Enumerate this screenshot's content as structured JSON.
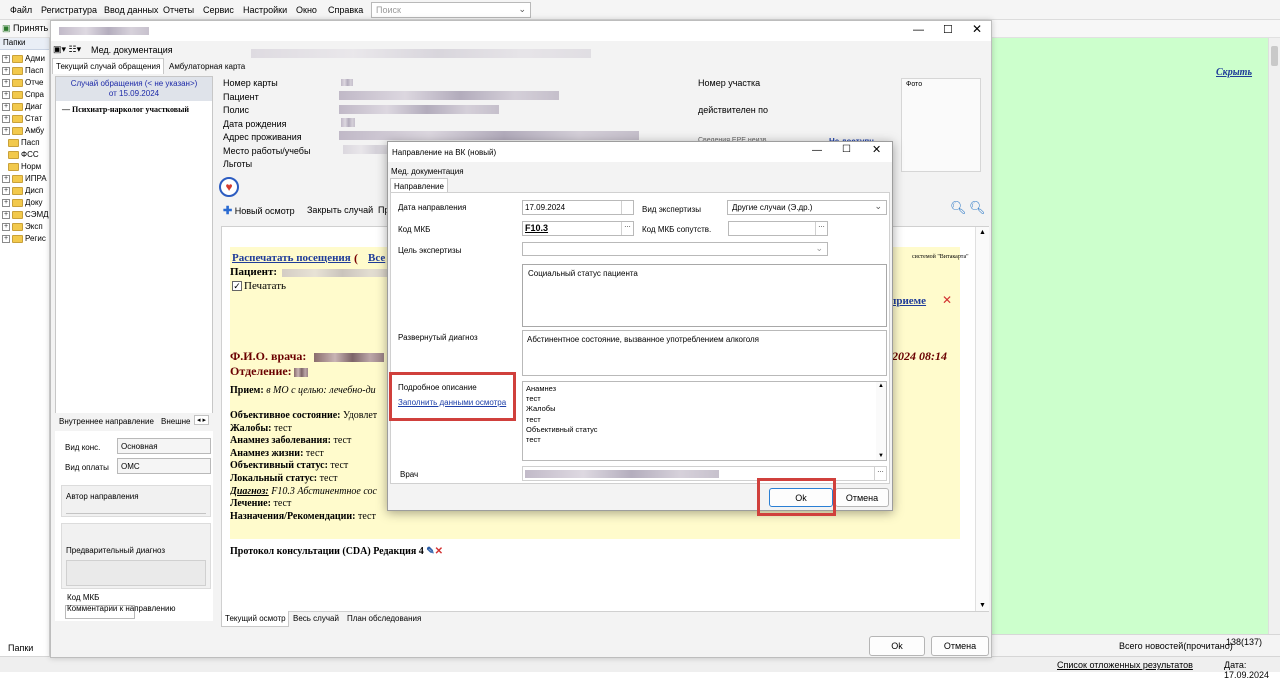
{
  "menu": {
    "items": [
      "Файл",
      "Регистратура",
      "Ввод данных",
      "Отчеты",
      "Сервис",
      "Настройки",
      "Окно",
      "Справка"
    ],
    "search_placeholder": "Поиск"
  },
  "toolbar": {
    "accept": "Принять"
  },
  "left_panel": {
    "title": "Папки",
    "folders": [
      "Адми",
      "Пасп",
      "Отче",
      "Спра",
      "Диаг",
      "Стат",
      "Амбу",
      "Пасп",
      "ФСС",
      "Норм",
      "ИПРА",
      "Дисп",
      "Доку",
      "СЭМД",
      "Эксп",
      "Регис"
    ],
    "bottom_tab": "Папки"
  },
  "right_panel": {
    "hide_link": "Скрыть",
    "news": "Всего новостей(прочитано)",
    "news_count": "138(137)",
    "deferred": "Список отложенных результатов",
    "date": "Дата: 17.09.2024"
  },
  "main_window": {
    "toolbar_label": "Мед. документация",
    "tabs": [
      "Текущий случай обращения",
      "Амбулаторная карта"
    ],
    "case": {
      "line1": "Случай обращения (< не указан>)",
      "line2": "от 15.09.2024",
      "doctor": "Психиатр-нарколог участковый"
    },
    "patient_labels": [
      "Номер карты",
      "Пациент",
      "Полис",
      "Дата рождения",
      "Адрес проживания",
      "Место работы/учебы",
      "Льготы"
    ],
    "right_labels": {
      "district": "Номер участка",
      "valid": "действителен по",
      "photo": "Фото",
      "fragment": "Сведения ЕРЕ неизв",
      "link": "Не доступн"
    },
    "actions": {
      "new_exam": "Новый осмотр",
      "close_case": "Закрыть случай",
      "extra": "Пр"
    },
    "left_tabs": [
      "Внутреннее направление",
      "Внешне"
    ],
    "form_labels": {
      "kind": "Вид конс.",
      "pay": "Вид оплаты",
      "author": "Автор направления",
      "prelim": "Предварительный диагноз",
      "mkb": "Код МКБ",
      "comment": "Комментарии к направлению"
    },
    "form_values": {
      "kind": "Основная",
      "pay": "ОМС"
    },
    "doc": {
      "print_visits": "Распечатать посещения",
      "paren": "(",
      "all": "Все",
      "patient": "Пациент:",
      "print": "Печатать",
      "fio": "Ф.И.О. врача:",
      "dept": "Отделение:",
      "reception_label": "Прием:",
      "reception_text": "в МО с целью:",
      "reception_italic": "лечебно-ди",
      "objective": "Объективное состояние:",
      "objective_text": "Удовлет",
      "complaints": "Жалобы:",
      "complaints_text": "тест",
      "anamnesis_dis": "Анамнез заболевания:",
      "anamnesis_dis_text": "тест",
      "anamnesis_life": "Анамнез жизни:",
      "anamnesis_life_text": "тест",
      "obj_status": "Объективный статус:",
      "obj_status_text": "тест",
      "local_status": "Локальный статус:",
      "local_status_text": "тест",
      "diagnosis": "Диагноз:",
      "diagnosis_text": "F10.3 Абстинентное сос",
      "treatment": "Лечение:",
      "treatment_text": "тест",
      "assign": "Назначения/Рекомендации:",
      "assign_text": "тест",
      "protocol": "Протокол консультации (CDA) Редакция 4",
      "date_frag": "2024 08:14",
      "side_link": "приеме",
      "system": "системой \"Витакарта\""
    },
    "bottom_tabs": [
      "Текущий осмотр",
      "Весь случай",
      "План обследования"
    ],
    "ok": "Ok",
    "cancel": "Отмена"
  },
  "dialog": {
    "title": "Направление на ВК (новый)",
    "toolbar": "Мед. документация",
    "tab": "Направление",
    "date_label": "Дата направления",
    "date_value": "17.09.2024",
    "expert_label": "Вид экспертизы",
    "expert_value": "Другие случаи (Э.др.)",
    "mkb_label": "Код МКБ",
    "mkb_value": "F10.3",
    "mkb2_label": "Код МКБ сопутств.",
    "goal_label": "Цель экспертизы",
    "social_text": "Социальный статус пациента",
    "diag_label": "Развернутый диагноз",
    "diag_text": "Абстинентное состояние, вызванное употреблением алкоголя",
    "detail_label": "Подробное описание",
    "fill_link": "Заполнить данными осмотра",
    "detail_lines": [
      "Анамнез",
      "тест",
      "Жалобы",
      "тест",
      "Объективный статус",
      "тест"
    ],
    "doctor_label": "Врач",
    "ok": "Ok",
    "cancel": "Отмена"
  },
  "colors": {
    "green": "#ccffcc",
    "yellow": "#fffbcc",
    "highlight": "#d0403c"
  }
}
